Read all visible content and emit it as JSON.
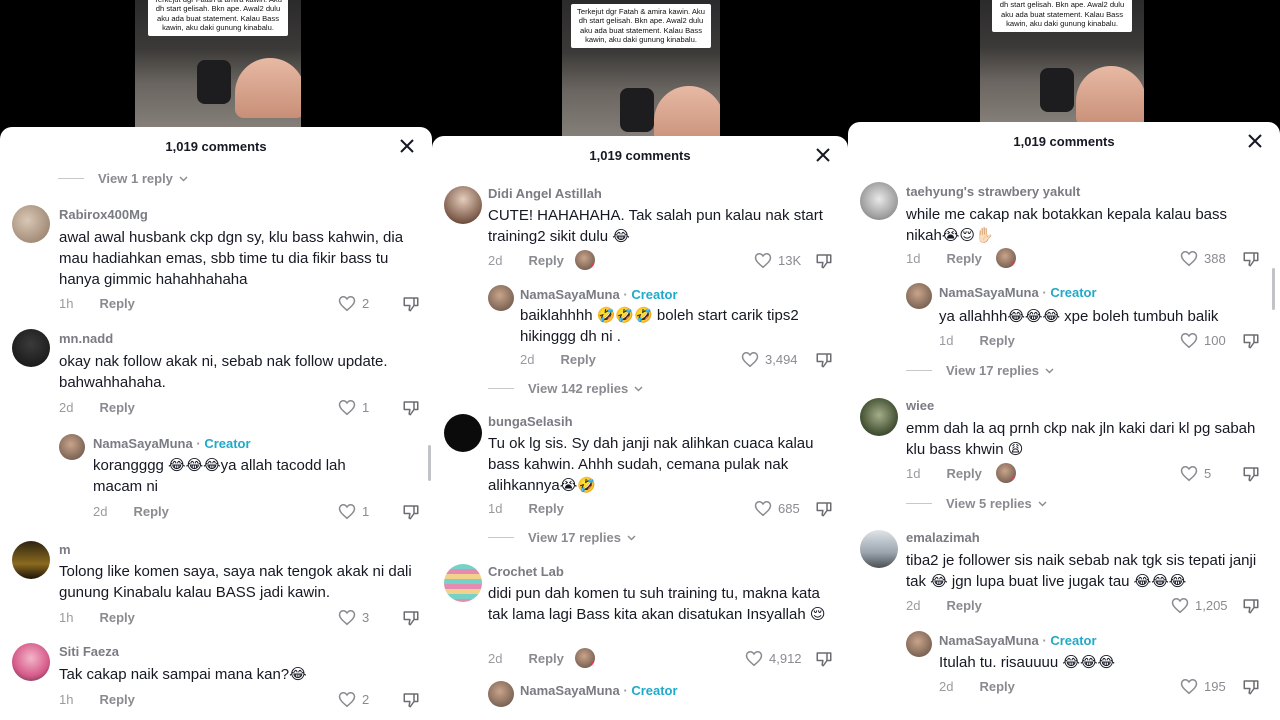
{
  "video_caption": "Terkejut dgr Fatah & amira kawin.  Aku  dh start gelisah. Bkn ape. Awal2 dulu aku ada buat statement. Kalau Bass kawin, aku daki gunung kinabalu.",
  "panels": [
    {
      "header": {
        "title": "1,019 comments"
      },
      "top_view_replies": "View 1 reply",
      "comments": [
        {
          "user": "Rabirox400Mg",
          "text": "awal awal husbank ckp dgn sy, klu bass kahwin, dia mau hadiahkan emas, sbb time tu dia fikir bass tu hanya gimmic hahahhahaha",
          "time": "1h",
          "reply": "Reply",
          "likes": "2"
        },
        {
          "user": "mn.nadd",
          "text": "okay nak follow akak ni, sebab nak follow update. bahwahhahaha.",
          "time": "2d",
          "reply": "Reply",
          "likes": "1"
        },
        {
          "user": "NamaSayaMuna",
          "creator": "Creator",
          "text": "korangggg 😂😂😂ya allah tacodd lah macam ni",
          "time": "2d",
          "reply": "Reply",
          "likes": "1"
        },
        {
          "user": "m",
          "text": "Tolong like komen saya, saya nak tengok akak ni dali gunung Kinabalu kalau BASS jadi kawin.",
          "time": "1h",
          "reply": "Reply",
          "likes": "3"
        },
        {
          "user": "Siti Faeza",
          "text": "Tak cakap naik sampai mana kan?😂",
          "time": "1h",
          "reply": "Reply",
          "likes": "2"
        }
      ]
    },
    {
      "header": {
        "title": "1,019 comments"
      },
      "comments": [
        {
          "user": "Didi Angel Astillah",
          "text": "CUTE! HAHAHAHA. Tak salah pun kalau nak start training2 sikit dulu 😂",
          "time": "2d",
          "reply": "Reply",
          "likes": "13K"
        },
        {
          "user": "NamaSayaMuna",
          "creator": "Creator",
          "text": "baiklahhhh 🤣🤣🤣 boleh start carik tips2 hikinggg dh ni .",
          "time": "2d",
          "reply": "Reply",
          "likes": "3,494"
        },
        {
          "user": "bungaSelasih",
          "text": "Tu ok lg sis. Sy dah janji nak alihkan cuaca kalau bass kahwin. Ahhh sudah, cemana pulak nak alihkannya😭🤣",
          "time": "1d",
          "reply": "Reply",
          "likes": "685"
        },
        {
          "user": "Crochet Lab",
          "text": "didi pun dah komen tu suh training tu, makna kata tak lama lagi Bass kita akan disatukan Insyallah 😌",
          "time": "2d",
          "reply": "Reply",
          "likes": "4,912"
        },
        {
          "user": "NamaSayaMuna",
          "creator": "Creator",
          "text": "",
          "time": "",
          "reply": "",
          "likes": ""
        }
      ],
      "view_replies": [
        "View 142 replies",
        "View 17 replies"
      ]
    },
    {
      "header": {
        "title": "1,019 comments"
      },
      "comments": [
        {
          "user": "taehyung's strawbery yakult",
          "text": "while me cakap nak botakkan kepala kalau bass nikah😭😌✋🏻",
          "time": "1d",
          "reply": "Reply",
          "likes": "388"
        },
        {
          "user": "NamaSayaMuna",
          "creator": "Creator",
          "text": "ya allahhh😂😂😂 xpe boleh tumbuh balik",
          "time": "1d",
          "reply": "Reply",
          "likes": "100"
        },
        {
          "user": "wiee",
          "text": "emm dah la aq prnh ckp nak jln kaki dari kl pg sabah klu bass khwin 😩",
          "time": "1d",
          "reply": "Reply",
          "likes": "5"
        },
        {
          "user": "emalazimah",
          "text": "tiba2 je follower sis naik sebab nak tgk sis tepati janji tak 😂 jgn lupa buat live jugak tau 😂😂😂",
          "time": "2d",
          "reply": "Reply",
          "likes": "1,205"
        },
        {
          "user": "NamaSayaMuna",
          "creator": "Creator",
          "text": "Itulah tu. risauuuu 😂😂😂",
          "time": "2d",
          "reply": "Reply",
          "likes": "195"
        }
      ],
      "view_replies": [
        "View 17 replies",
        "View 5 replies"
      ]
    }
  ],
  "separator": "·",
  "colors": {
    "creator": "#21a9c9",
    "like_heart": "#fe2c55",
    "muted": "#8a8b91"
  }
}
